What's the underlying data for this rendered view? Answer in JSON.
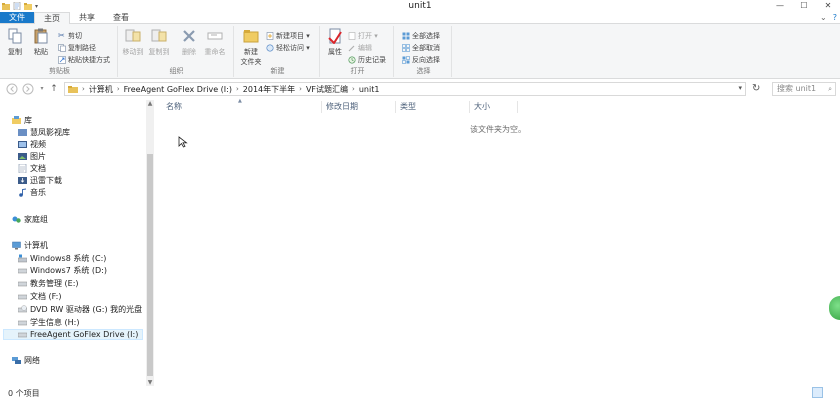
{
  "window": {
    "title": "unit1",
    "minimize_glyph": "—",
    "maximize_glyph": "☐",
    "close_glyph": "✕"
  },
  "ribbon_tabs": [
    {
      "label": "文件"
    },
    {
      "label": "主页"
    },
    {
      "label": "共享"
    },
    {
      "label": "查看"
    }
  ],
  "ribbon": {
    "clipboard": {
      "label": "剪贴板",
      "copy": "复制",
      "paste": "粘贴",
      "cut": "剪切",
      "copy_path": "复制路径",
      "paste_shortcut": "粘贴快捷方式"
    },
    "organize": {
      "label": "组织",
      "move_to": "移动到",
      "copy_to": "复制到",
      "delete": "删除",
      "rename": "重命名"
    },
    "new": {
      "label": "新建",
      "new_folder_line1": "新建",
      "new_folder_line2": "文件夹",
      "new_item": "新建项目 ▾",
      "easy_access": "轻松访问 ▾"
    },
    "open": {
      "label": "打开",
      "properties": "属性",
      "open": "打开 ▾",
      "edit": "编辑",
      "history": "历史记录"
    },
    "select": {
      "label": "选择",
      "select_all": "全部选择",
      "select_none": "全部取消",
      "invert": "反向选择"
    }
  },
  "address": {
    "crumbs": [
      "计算机",
      "FreeAgent GoFlex Drive (I:)",
      "2014年下半年",
      "VF试题汇编",
      "unit1"
    ],
    "search_placeholder": "搜索 unit1"
  },
  "nav_pane": {
    "items": [
      {
        "label": "库"
      },
      {
        "label": "慧凤影视库"
      },
      {
        "label": "视频"
      },
      {
        "label": "图片"
      },
      {
        "label": "文档"
      },
      {
        "label": "迅雷下载"
      },
      {
        "label": "音乐"
      },
      {
        "label": "家庭组"
      },
      {
        "label": "计算机"
      },
      {
        "label": "Windows8 系统 (C:)"
      },
      {
        "label": "Windows7 系统 (D:)"
      },
      {
        "label": "教务管理 (E:)"
      },
      {
        "label": "文档 (F:)"
      },
      {
        "label": "DVD RW 驱动器 (G:) 我的光盘"
      },
      {
        "label": "学生信息 (H:)"
      },
      {
        "label": "FreeAgent GoFlex Drive (I:)"
      },
      {
        "label": "网络"
      }
    ]
  },
  "columns": [
    "名称",
    "修改日期",
    "类型",
    "大小"
  ],
  "empty_message": "该文件夹为空。",
  "status": {
    "item_count": "0 个项目"
  },
  "colors": {
    "file_tab": "#1979ca",
    "ribbon_bg": "#f5f6f7",
    "selection": "#e5f3fb"
  }
}
